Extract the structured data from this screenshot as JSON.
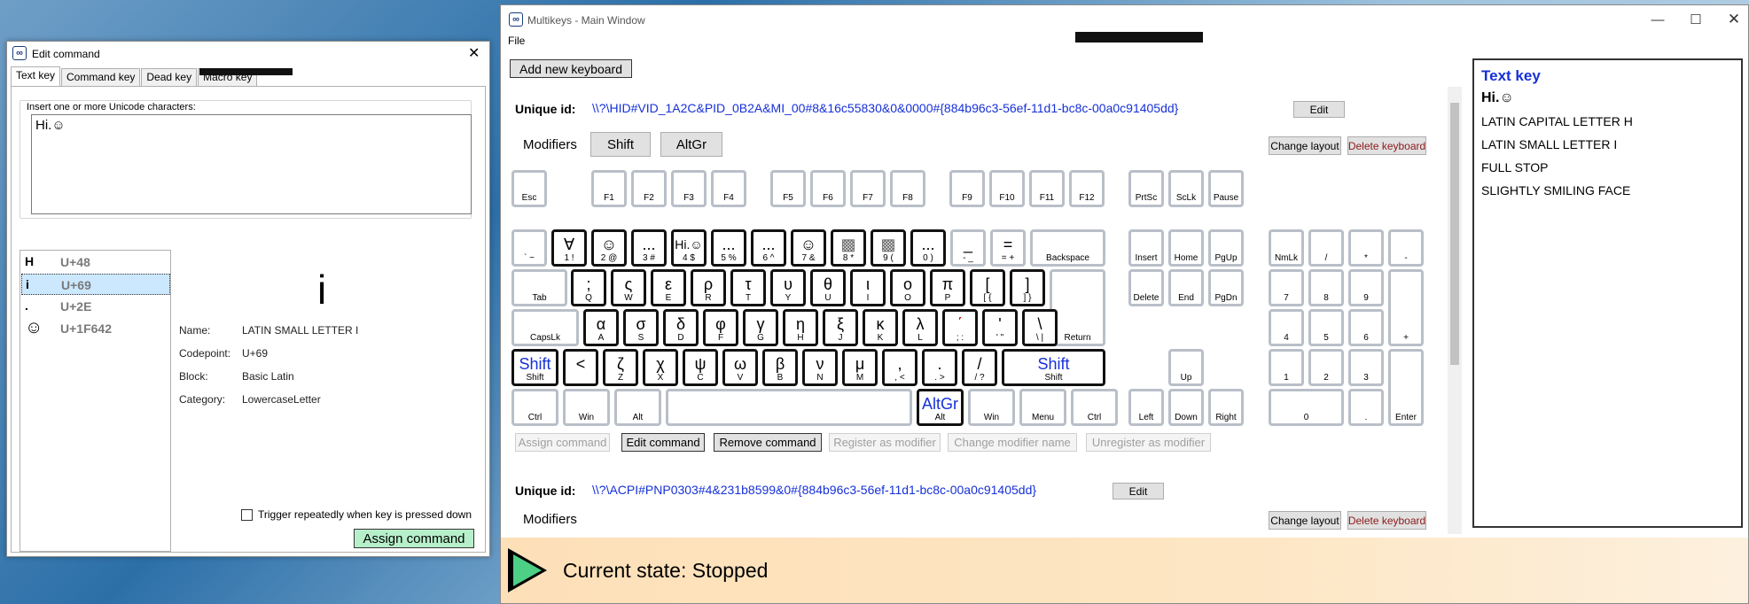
{
  "edit_window": {
    "title": "Edit command",
    "close_glyph": "✕",
    "tabs": [
      "Text key",
      "Command key",
      "Dead key",
      "Macro key"
    ],
    "group_label": "Insert one or more Unicode characters:",
    "input_value": "Hi.☺",
    "chars": [
      {
        "glyph": "H",
        "codepoint": "U+48"
      },
      {
        "glyph": "i",
        "codepoint": "U+69"
      },
      {
        "glyph": ".",
        "codepoint": "U+2E"
      },
      {
        "glyph": "☺",
        "codepoint": "U+1F642"
      }
    ],
    "preview_glyph": "i",
    "details": {
      "name_label": "Name:",
      "name_value": "LATIN SMALL LETTER I",
      "codepoint_label": "Codepoint:",
      "codepoint_value": "U+69",
      "block_label": "Block:",
      "block_value": "Basic Latin",
      "category_label": "Category:",
      "category_value": "LowercaseLetter"
    },
    "trigger_label": "Trigger repeatedly when key is pressed down",
    "assign_button": "Assign command"
  },
  "main_window": {
    "title": "Multikeys - Main Window",
    "menu_file": "File",
    "add_keyboard": "Add new keyboard",
    "keyboard1": {
      "id_label": "Unique id:",
      "id_value": "\\\\?\\HID#VID_1A2C&PID_0B2A&MI_00#8&16c55830&0&0000#{884b96c3-56ef-11d1-bc8c-00a0c91405dd}",
      "edit": "Edit",
      "modifiers_label": "Modifiers",
      "modifiers": [
        "Shift",
        "AltGr"
      ],
      "change_layout": "Change layout",
      "delete_keyboard": "Delete keyboard"
    },
    "actions": [
      "Assign command",
      "Edit command",
      "Remove command",
      "Register as modifier",
      "Change modifier name",
      "Unregister as modifier"
    ],
    "keyboard2": {
      "id_label": "Unique id:",
      "id_value": "\\\\?\\ACPI#PNP0303#4&231b8599&0#{884b96c3-56ef-11d1-bc8c-00a0c91405dd}",
      "edit": "Edit",
      "modifiers_label": "Modifiers",
      "change_layout": "Change layout",
      "delete_keyboard": "Delete keyboard"
    },
    "side_panel": {
      "title": "Text key",
      "value": "Hi.☺",
      "items": [
        "LATIN CAPITAL LETTER H",
        "LATIN SMALL LETTER I",
        "FULL STOP",
        "SLIGHTLY SMILING FACE"
      ]
    },
    "status": "Current state: Stopped",
    "keys": {
      "esc": "Esc",
      "f1": "F1",
      "f2": "F2",
      "f3": "F3",
      "f4": "F4",
      "f5": "F5",
      "f6": "F6",
      "f7": "F7",
      "f8": "F8",
      "f9": "F9",
      "f10": "F10",
      "f11": "F11",
      "f12": "F12",
      "prtsc": "PrtSc",
      "sclk": "ScLk",
      "pause": "Pause",
      "grave": "` ~",
      "k1": "1 !",
      "k2": "2 @",
      "k3": "3 #",
      "k4": "4 $",
      "k5": "5 %",
      "k6": "6 ^",
      "k7": "7 &",
      "k8": "8 *",
      "k9": "9 (",
      "k0": "0 )",
      "minus": "- _",
      "equal": "= +",
      "backspace": "Backspace",
      "insert": "Insert",
      "home": "Home",
      "pgup": "PgUp",
      "nmlk": "NmLk",
      "np_div": "/",
      "np_mul": "*",
      "np_minus": "-",
      "tab": "Tab",
      "q": "Q",
      "w": "W",
      "e": "E",
      "r": "R",
      "t": "T",
      "y": "Y",
      "u": "U",
      "i": "I",
      "o": "O",
      "p": "P",
      "lbr": "[ {",
      "rbr": "] }",
      "delete": "Delete",
      "end": "End",
      "pgdn": "PgDn",
      "np7": "7",
      "np8": "8",
      "np9": "9",
      "capslk": "CapsLk",
      "a": "A",
      "s": "S",
      "d": "D",
      "f": "F",
      "g": "G",
      "h": "H",
      "j": "J",
      "k": "K",
      "l": "L",
      "semi": "; :",
      "quote": "' \"",
      "bslash": "\\ |",
      "return": "Return",
      "np4": "4",
      "np5": "5",
      "np6": "6",
      "np_plus": "+",
      "shift": "Shift",
      "z": "Z",
      "x": "X",
      "c": "C",
      "v": "V",
      "b": "B",
      "n": "N",
      "m": "M",
      "comma": ", <",
      "period": ". >",
      "slash": "/ ?",
      "rshift": "Shift",
      "up": "Up",
      "np1": "1",
      "np2": "2",
      "np3": "3",
      "ctrl": "Ctrl",
      "win": "Win",
      "alt": "Alt",
      "ralt": "Alt",
      "rwin": "Win",
      "menu": "Menu",
      "rctrl": "Ctrl",
      "left": "Left",
      "down": "Down",
      "right": "Right",
      "np0": "0",
      "np_dot": ".",
      "enter": "Enter"
    },
    "key_glyphs": {
      "k1": "∀",
      "k2": "☺",
      "k3": "...",
      "k4": "Hi.☺",
      "k5": "...",
      "k6": "...",
      "k7": "☺",
      "k8": "▩",
      "k9": "▩",
      "k0": "...",
      "minus": "_",
      "equal": "=",
      "q": ";",
      "w": "ς",
      "e": "ε",
      "r": "ρ",
      "t": "τ",
      "y": "υ",
      "u": "θ",
      "i": "ι",
      "o": "ο",
      "p": "π",
      "lbr": "[",
      "rbr": "]",
      "a": "α",
      "s": "σ",
      "d": "δ",
      "f": "φ",
      "g": "γ",
      "h": "η",
      "j": "ξ",
      "k": "κ",
      "l": "λ",
      "semi": "΄",
      "quote": "'",
      "bslash": "\\",
      "lshift": "Shift",
      "oem102": "<",
      "z": "ζ",
      "x": "χ",
      "c": "ψ",
      "v": "ω",
      "b": "β",
      "n": "ν",
      "m": "μ",
      "comma": ",",
      "period": ".",
      "slash": "/",
      "rshift": "Shift",
      "ralt": "AltGr"
    }
  }
}
